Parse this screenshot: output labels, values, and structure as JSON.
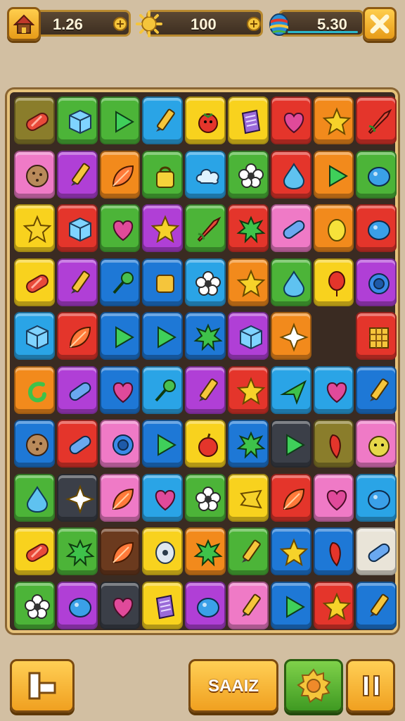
{
  "hud": {
    "lives_value": "1.26",
    "coins_value": "100",
    "gems_value": "5.30",
    "plus_symbol": "+"
  },
  "icons": {
    "home": "house-icon",
    "coin": "sun-coin-icon",
    "gem": "striped-egg-icon",
    "close": "close-icon",
    "back": "exit-icon",
    "settings": "gear-badge-icon",
    "pause": "pause-icon"
  },
  "buttons": {
    "shuffle_label": "SAAIZ"
  },
  "colors": {
    "R": "#e4352b",
    "O": "#f28a1c",
    "Y": "#f8d21e",
    "G": "#4cb438",
    "B": "#1e78d6",
    "L": "#2aa4e6",
    "P": "#b03fd6",
    "K": "#ef7ac6",
    "W": "#e9e4d8",
    "D": "#3b3f48",
    "N": "#6b3a1e",
    "E": "#8a7d2b"
  },
  "board": {
    "rows": [
      [
        {
          "c": "E",
          "i": "candy"
        },
        {
          "c": "G",
          "i": "cube"
        },
        {
          "c": "G",
          "i": "triangle"
        },
        {
          "c": "L",
          "i": "pencil"
        },
        {
          "c": "Y",
          "i": "tomato"
        },
        {
          "c": "Y",
          "i": "box"
        },
        {
          "c": "R",
          "i": "heart"
        },
        {
          "c": "O",
          "i": "star"
        },
        {
          "c": "R",
          "i": "rocket"
        }
      ],
      [
        {
          "c": "K",
          "i": "cookie"
        },
        {
          "c": "P",
          "i": "pencil"
        },
        {
          "c": "O",
          "i": "leaf"
        },
        {
          "c": "G",
          "i": "bag"
        },
        {
          "c": "L",
          "i": "cloud"
        },
        {
          "c": "G",
          "i": "flower"
        },
        {
          "c": "R",
          "i": "drop"
        },
        {
          "c": "O",
          "i": "triangle"
        },
        {
          "c": "G",
          "i": "blob"
        }
      ],
      [
        {
          "c": "Y",
          "i": "star"
        },
        {
          "c": "R",
          "i": "cube"
        },
        {
          "c": "G",
          "i": "heart"
        },
        {
          "c": "P",
          "i": "star"
        },
        {
          "c": "G",
          "i": "rocket"
        },
        {
          "c": "R",
          "i": "splat"
        },
        {
          "c": "K",
          "i": "capsule"
        },
        {
          "c": "O",
          "i": "lemon"
        },
        {
          "c": "R",
          "i": "blob"
        }
      ],
      [
        {
          "c": "Y",
          "i": "candy"
        },
        {
          "c": "P",
          "i": "pencil"
        },
        {
          "c": "B",
          "i": "key"
        },
        {
          "c": "B",
          "i": "square"
        },
        {
          "c": "L",
          "i": "flower"
        },
        {
          "c": "O",
          "i": "star"
        },
        {
          "c": "G",
          "i": "drop"
        },
        {
          "c": "Y",
          "i": "balloon"
        },
        {
          "c": "P",
          "i": "ring"
        }
      ],
      [
        {
          "c": "L",
          "i": "cube"
        },
        {
          "c": "R",
          "i": "leaf"
        },
        {
          "c": "B",
          "i": "triangle"
        },
        {
          "c": "B",
          "i": "triangle"
        },
        {
          "c": "B",
          "i": "splat"
        },
        {
          "c": "P",
          "i": "cube"
        },
        {
          "c": "O",
          "i": "star4"
        },
        {
          "c": "D",
          "i": "none"
        },
        {
          "c": "R",
          "i": "crate"
        }
      ],
      [
        {
          "c": "O",
          "i": "hook"
        },
        {
          "c": "P",
          "i": "capsule"
        },
        {
          "c": "B",
          "i": "heart"
        },
        {
          "c": "L",
          "i": "key"
        },
        {
          "c": "P",
          "i": "pencil"
        },
        {
          "c": "R",
          "i": "star"
        },
        {
          "c": "L",
          "i": "arrow"
        },
        {
          "c": "L",
          "i": "heart"
        },
        {
          "c": "B",
          "i": "pencil"
        }
      ],
      [
        {
          "c": "B",
          "i": "cookie"
        },
        {
          "c": "R",
          "i": "capsule"
        },
        {
          "c": "K",
          "i": "ring"
        },
        {
          "c": "B",
          "i": "triangle"
        },
        {
          "c": "Y",
          "i": "apple"
        },
        {
          "c": "B",
          "i": "splat"
        },
        {
          "c": "D",
          "i": "triangle"
        },
        {
          "c": "E",
          "i": "pepper"
        },
        {
          "c": "K",
          "i": "face"
        }
      ],
      [
        {
          "c": "G",
          "i": "drop"
        },
        {
          "c": "D",
          "i": "star4"
        },
        {
          "c": "K",
          "i": "leaf"
        },
        {
          "c": "L",
          "i": "heart"
        },
        {
          "c": "G",
          "i": "flower"
        },
        {
          "c": "Y",
          "i": "ribbon"
        },
        {
          "c": "R",
          "i": "leaf"
        },
        {
          "c": "K",
          "i": "heart"
        },
        {
          "c": "L",
          "i": "blob"
        }
      ],
      [
        {
          "c": "Y",
          "i": "candy"
        },
        {
          "c": "G",
          "i": "splat"
        },
        {
          "c": "N",
          "i": "leaf"
        },
        {
          "c": "Y",
          "i": "egg"
        },
        {
          "c": "O",
          "i": "splat"
        },
        {
          "c": "G",
          "i": "pencil"
        },
        {
          "c": "B",
          "i": "star"
        },
        {
          "c": "B",
          "i": "pepper"
        },
        {
          "c": "W",
          "i": "capsule"
        }
      ],
      [
        {
          "c": "G",
          "i": "flower"
        },
        {
          "c": "P",
          "i": "blob"
        },
        {
          "c": "D",
          "i": "heart"
        },
        {
          "c": "Y",
          "i": "box"
        },
        {
          "c": "P",
          "i": "blob"
        },
        {
          "c": "K",
          "i": "pencil"
        },
        {
          "c": "B",
          "i": "triangle"
        },
        {
          "c": "R",
          "i": "star"
        },
        {
          "c": "B",
          "i": "pencil"
        }
      ]
    ]
  }
}
